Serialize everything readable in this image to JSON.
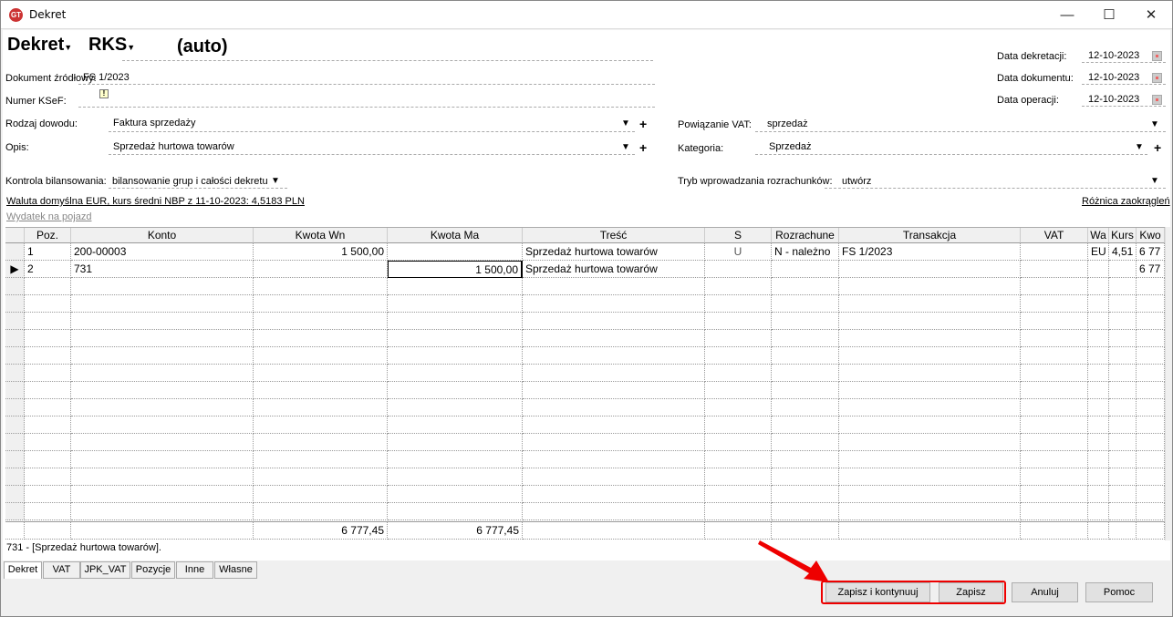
{
  "window": {
    "title": "Dekret",
    "minimize": "—",
    "maximize": "☐",
    "close": "✕"
  },
  "header": {
    "doc_type": "Dekret",
    "journal": "RKS",
    "number": "(auto)"
  },
  "fields": {
    "dokument_zrodlowy": {
      "label": "Dokument źródłowy:",
      "value": "FS 1/2023"
    },
    "numer_ksef": {
      "label": "Numer KSeF:",
      "value": ""
    },
    "rodzaj_dowodu": {
      "label": "Rodzaj dowodu:",
      "value": "Faktura sprzedaży"
    },
    "opis": {
      "label": "Opis:",
      "value": "Sprzedaż hurtowa towarów"
    },
    "kontrola": {
      "label": "Kontrola bilansowania:",
      "value": "bilansowanie grup i całości dekretu"
    },
    "data_dekretacji": {
      "label": "Data dekretacji:",
      "value": "12-10-2023"
    },
    "data_dokumentu": {
      "label": "Data dokumentu:",
      "value": "12-10-2023"
    },
    "data_operacji": {
      "label": "Data operacji:",
      "value": "12-10-2023"
    },
    "powiazanie_vat": {
      "label": "Powiązanie VAT:",
      "value": "sprzedaż"
    },
    "kategoria": {
      "label": "Kategoria:",
      "value": "Sprzedaż"
    },
    "tryb": {
      "label": "Tryb wprowadzania rozrachunków:",
      "value": "utwórz"
    }
  },
  "links": {
    "waluta": "Waluta domyślna EUR, kurs średni NBP z 11-10-2023: 4,5183 PLN",
    "wydatek": "Wydatek na pojazd",
    "roznica": "Różnica zaokrągleń"
  },
  "grid": {
    "columns": [
      "",
      "Poz.",
      "Konto",
      "Kwota Wn",
      "Kwota Ma",
      "Treść",
      "S",
      "Rozrachune",
      "Transakcja",
      "VAT",
      "Wa",
      "Kurs",
      "Kwo"
    ],
    "rows": [
      [
        "",
        "1",
        "200-00003",
        "1 500,00",
        "",
        "Sprzedaż hurtowa towarów",
        "U",
        "N - należno",
        "FS 1/2023",
        "",
        "EU",
        "4,51",
        "6 77"
      ],
      [
        "▶",
        "2",
        "731",
        "",
        "1 500,00",
        "Sprzedaż hurtowa towarów",
        "",
        "",
        "",
        "",
        "",
        "",
        "6 77"
      ]
    ],
    "totals": {
      "wn": "6 777,45",
      "ma": "6 777,45"
    }
  },
  "status": "731 - [Sprzedaż hurtowa towarów].",
  "tabs": [
    "Dekret",
    "VAT",
    "JPK_VAT",
    "Pozycje",
    "Inne",
    "Własne"
  ],
  "buttons": {
    "save_continue": "Zapisz i kontynuuj",
    "save": "Zapisz",
    "cancel": "Anuluj",
    "help": "Pomoc"
  },
  "colors": {
    "highlight": "#e00000"
  }
}
